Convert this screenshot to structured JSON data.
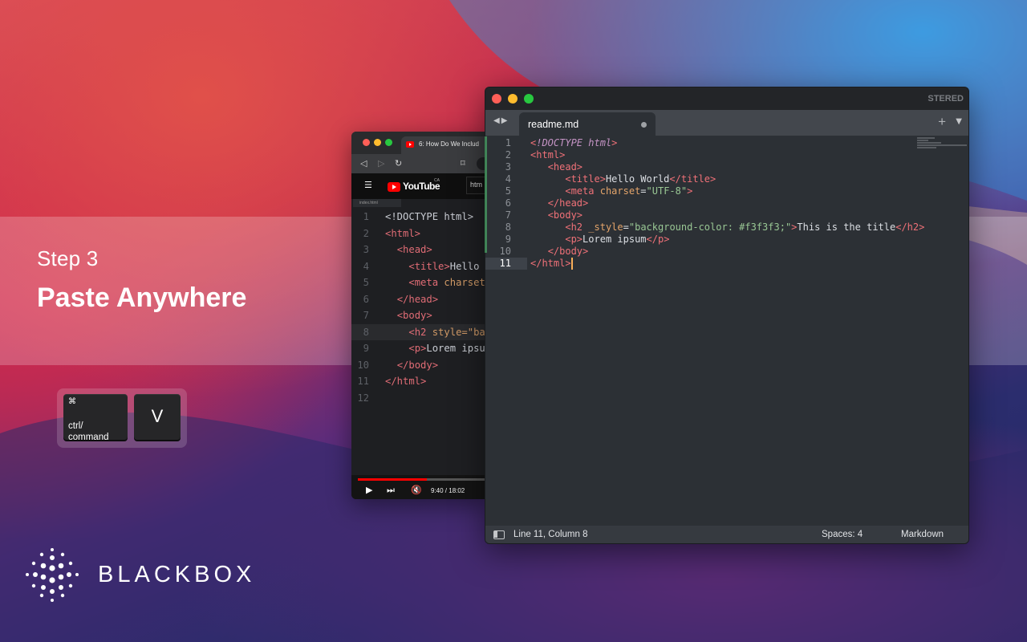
{
  "step": {
    "label": "Step 3",
    "title": "Paste Anywhere"
  },
  "keys": {
    "modifier_symbol": "⌘",
    "modifier_label": "ctrl/\ncommand",
    "key_label": "V"
  },
  "brand": {
    "name": "BLACKBOX"
  },
  "browser": {
    "tab_title": "6: How Do We Includ",
    "youtube_wordmark": "YouTube",
    "youtube_region": "CA",
    "search_text": "htm",
    "file_tab": "index.html",
    "highlighted_line": 8,
    "code_lines": [
      {
        "n": "1",
        "html": "<span>&lt;!DOCTYPE html&gt;</span>"
      },
      {
        "n": "2",
        "html": "<span class=\"t\">&lt;html&gt;</span>"
      },
      {
        "n": "3",
        "html": "  <span class=\"t\">&lt;head&gt;</span>"
      },
      {
        "n": "4",
        "html": "    <span class=\"t\">&lt;title&gt;</span>Hello"
      },
      {
        "n": "5",
        "html": "    <span class=\"t\">&lt;meta</span> <span class=\"a\">charset</span>"
      },
      {
        "n": "6",
        "html": "  <span class=\"t\">&lt;/head&gt;</span>"
      },
      {
        "n": "7",
        "html": "  <span class=\"t\">&lt;body&gt;</span>"
      },
      {
        "n": "8",
        "html": "    <span class=\"t\">&lt;h2</span> <span class=\"a\">style=\"ba</span>"
      },
      {
        "n": "9",
        "html": "    <span class=\"t\">&lt;p&gt;</span>Lorem ipsu"
      },
      {
        "n": "10",
        "html": "  <span class=\"t\">&lt;/body&gt;</span>"
      },
      {
        "n": "11",
        "html": "<span class=\"t\">&lt;/html&gt;</span>"
      },
      {
        "n": "12",
        "html": ""
      }
    ],
    "time": "9:40 / 18:02",
    "progress_fraction": 0.54
  },
  "editor": {
    "app_title": "STERED",
    "tab_label": "readme.md",
    "tab_modified": true,
    "current_line": 11,
    "code_lines": [
      {
        "n": "1",
        "html": "<span class=\"tg\">&lt;</span><span class=\"dt\">!DOCTYPE html</span><span class=\"tg\">&gt;</span>"
      },
      {
        "n": "2",
        "html": "<span class=\"tg\">&lt;html&gt;</span>"
      },
      {
        "n": "3",
        "html": "   <span class=\"tg\">&lt;head&gt;</span>"
      },
      {
        "n": "4",
        "html": "      <span class=\"tg\">&lt;title&gt;</span><span class=\"pl\">Hello World</span><span class=\"tg\">&lt;/title&gt;</span>"
      },
      {
        "n": "5",
        "html": "      <span class=\"tg\">&lt;meta</span> <span class=\"at\">charset</span><span class=\"pl\">=</span><span class=\"st\">\"UTF-8\"</span><span class=\"tg\">&gt;</span>"
      },
      {
        "n": "6",
        "html": "   <span class=\"tg\">&lt;/head&gt;</span>"
      },
      {
        "n": "7",
        "html": "   <span class=\"tg\">&lt;body&gt;</span>"
      },
      {
        "n": "8",
        "html": "      <span class=\"tg\">&lt;h2</span> <span class=\"at\">_style</span><span class=\"pl\">=</span><span class=\"st\">\"background-color: #f3f3f3;\"</span><span class=\"tg\">&gt;</span><span class=\"pl\">This is the title</span><span class=\"tg\">&lt;/h2&gt;</span>"
      },
      {
        "n": "9",
        "html": "      <span class=\"tg\">&lt;p&gt;</span><span class=\"pl\">Lorem ipsum</span><span class=\"tg\">&lt;/p&gt;</span>"
      },
      {
        "n": "10",
        "html": "   <span class=\"tg\">&lt;/body&gt;</span>"
      },
      {
        "n": "11",
        "html": "<span class=\"tg\">&lt;/html&gt;</span><span class=\"cursor\"></span>"
      }
    ],
    "status": {
      "position": "Line 11, Column 8",
      "spaces": "Spaces: 4",
      "syntax": "Markdown"
    }
  },
  "colors": {
    "traffic_red": "#ff5f57",
    "traffic_yellow": "#febc2e",
    "traffic_green": "#28c840",
    "youtube_red": "#ff0000",
    "cursor": "#f9ae58"
  }
}
